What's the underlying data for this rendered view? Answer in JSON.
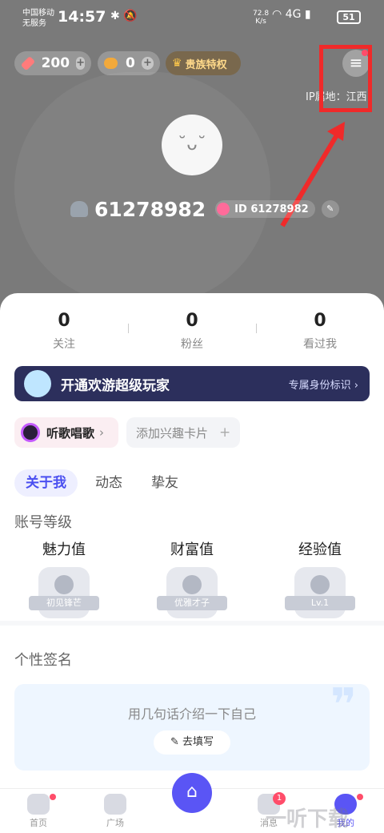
{
  "status_bar": {
    "carrier_top": "中国移动",
    "carrier_bottom": "无服务",
    "time": "14:57",
    "speed_value": "72.8",
    "speed_unit": "K/s",
    "network": "4G",
    "battery": "51"
  },
  "header": {
    "gems": "200",
    "beans": "0",
    "vip_label": "贵族特权",
    "ip_location": "IP属地：江西"
  },
  "profile": {
    "username": "61278982",
    "id_label": "ID 61278982"
  },
  "stats": [
    {
      "value": "0",
      "label": "关注"
    },
    {
      "value": "0",
      "label": "粉丝"
    },
    {
      "value": "0",
      "label": "看过我"
    }
  ],
  "banner": {
    "title": "开通欢游超级玩家",
    "right": "专属身份标识 ›"
  },
  "interest_tags": {
    "tag": "听歌唱歌",
    "add": "添加兴趣卡片"
  },
  "tabs": [
    {
      "label": "关于我",
      "active": true
    },
    {
      "label": "动态",
      "active": false
    },
    {
      "label": "挚友",
      "active": false
    }
  ],
  "account_level": {
    "title": "账号等级",
    "items": [
      {
        "name": "魅力值",
        "badge": "初见锋芒"
      },
      {
        "name": "财富值",
        "badge": "优雅才子"
      },
      {
        "name": "经验值",
        "badge": "Lv.1"
      }
    ]
  },
  "signature": {
    "title": "个性签名",
    "hint": "用几句话介绍一下自己",
    "button": "去填写"
  },
  "nav": [
    {
      "label": "首页",
      "icon": "gamepad-icon"
    },
    {
      "label": "广场",
      "icon": "planet-icon"
    },
    {
      "label": "",
      "icon": "home-icon"
    },
    {
      "label": "消息",
      "icon": "message-icon",
      "badge": "1"
    },
    {
      "label": "我的",
      "icon": "profile-icon"
    }
  ],
  "watermark": "一听下载"
}
